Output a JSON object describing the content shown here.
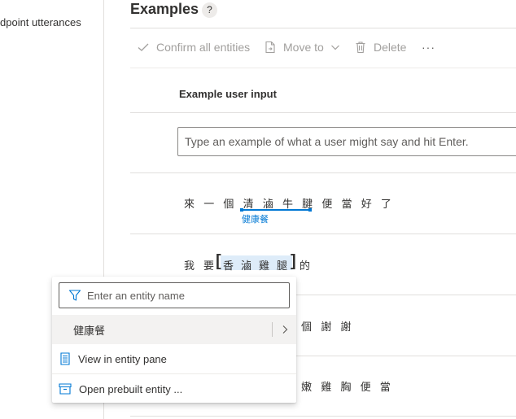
{
  "sidebar": {
    "item_label": "dpoint utterances"
  },
  "header": {
    "title": "Examples",
    "help": "?"
  },
  "toolbar": {
    "confirm_label": "Confirm all entities",
    "move_label": "Move to",
    "delete_label": "Delete",
    "more_label": "···"
  },
  "table": {
    "column_header": "Example user input"
  },
  "new_input": {
    "placeholder": "Type an example of what a user might say and hit Enter."
  },
  "utterances": [
    {
      "tokens": [
        "來",
        "一",
        "個",
        "清",
        "滷",
        "牛",
        "腱",
        "便",
        "當",
        "好",
        "了"
      ],
      "entity_label": "健康餐"
    },
    {
      "tokens": [
        "我",
        "要",
        "香",
        "滷",
        "雞",
        "腿",
        "的"
      ]
    },
    {
      "tokens": [
        "個",
        "謝",
        "謝"
      ]
    },
    {
      "tokens": [
        "嫩",
        "雞",
        "胸",
        "便",
        "當"
      ]
    }
  ],
  "entity_menu": {
    "filter_placeholder": "Enter an entity name",
    "selected_entity": "健康餐",
    "view_in_pane": "View in entity pane",
    "open_prebuilt": "Open prebuilt entity ..."
  },
  "colors": {
    "accent": "#0078d4",
    "selection": "#deecf9",
    "divider": "#e1dfdd",
    "disabled": "#a19f9d"
  }
}
